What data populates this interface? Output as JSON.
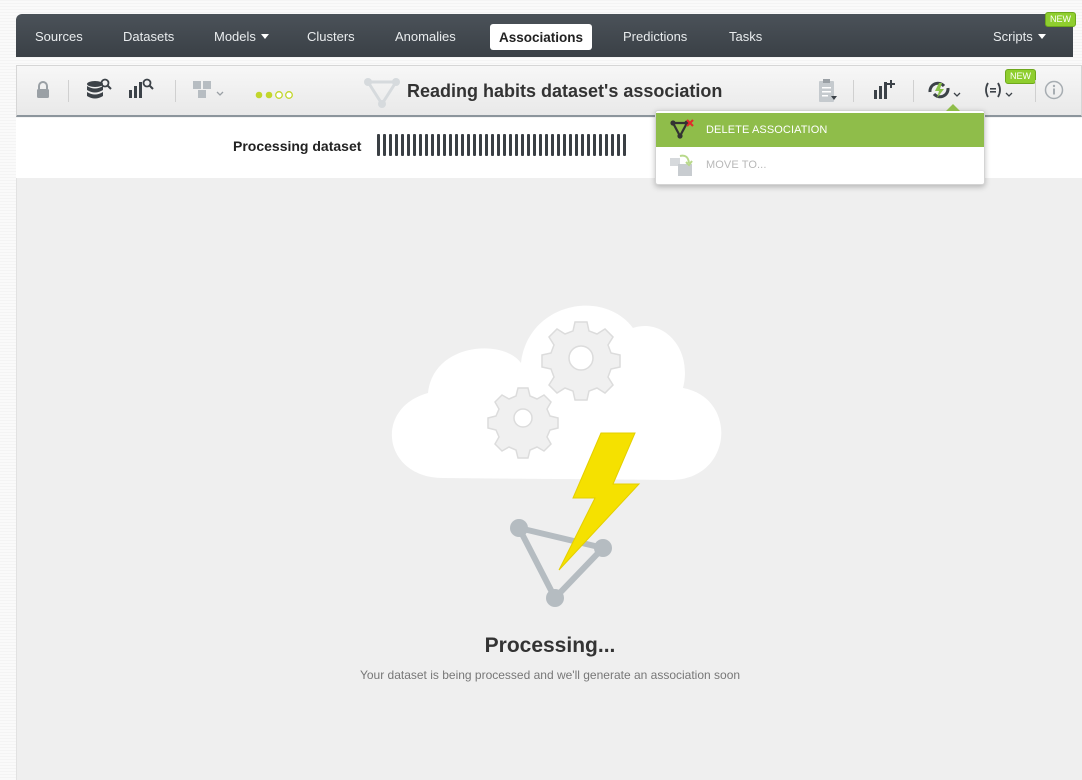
{
  "nav": {
    "items": [
      "Sources",
      "Datasets",
      "Models",
      "Clusters",
      "Anomalies",
      "Associations",
      "Predictions",
      "Tasks"
    ],
    "scripts_label": "Scripts",
    "new_badge": "NEW"
  },
  "toolbar": {
    "title": "Reading habits dataset's association",
    "new_badge": "NEW",
    "dots_colors": [
      "#8bc34a",
      "#8bc34a",
      "#c6d84a",
      "#d9e26a"
    ]
  },
  "progress": {
    "label": "Processing dataset",
    "bars_visible": 42
  },
  "dropdown": {
    "items": [
      {
        "label": "DELETE ASSOCIATION",
        "icon": "delete-association-icon",
        "state": "highlighted"
      },
      {
        "label": "MOVE TO...",
        "icon": "move-to-icon",
        "state": "disabled"
      }
    ]
  },
  "main": {
    "title": "Processing...",
    "subtitle": "Your dataset is being processed and we'll generate an association soon"
  },
  "colors": {
    "nav_bg": "#41474d",
    "accent_green": "#8fbd4a",
    "bolt_yellow": "#f5e100"
  }
}
